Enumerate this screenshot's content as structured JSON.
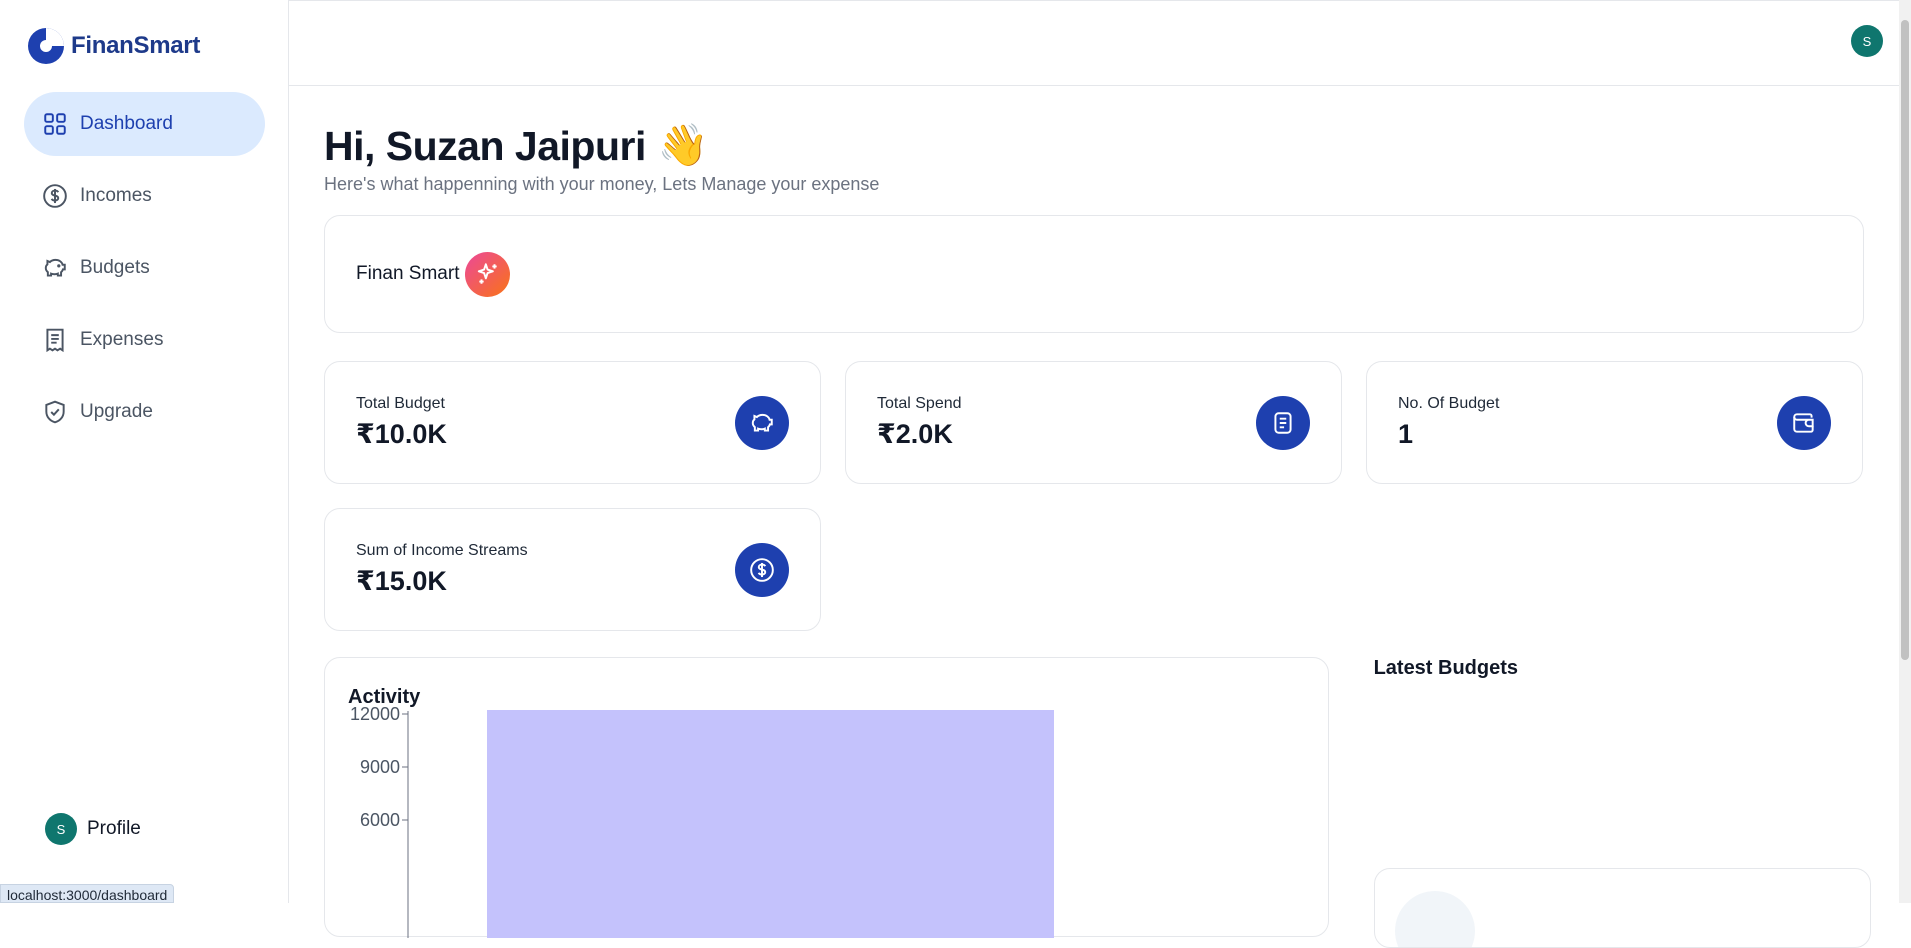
{
  "brand": {
    "name": "FinanSmart"
  },
  "sidebar": {
    "items": [
      {
        "label": "Dashboard",
        "icon": "dashboard-grid-icon",
        "active": true
      },
      {
        "label": "Incomes",
        "icon": "dollar-circle-icon",
        "active": false
      },
      {
        "label": "Budgets",
        "icon": "piggy-bank-icon",
        "active": false
      },
      {
        "label": "Expenses",
        "icon": "receipt-icon",
        "active": false
      },
      {
        "label": "Upgrade",
        "icon": "shield-check-icon",
        "active": false
      }
    ],
    "profile": {
      "label": "Profile",
      "avatar_initial": "S"
    }
  },
  "topbar": {
    "avatar_initial": "S"
  },
  "status_bar": {
    "url": "localhost:3000/dashboard"
  },
  "greeting": {
    "title": "Hi, Suzan Jaipuri",
    "emoji": "👋",
    "subtitle": "Here's what happenning with your money, Lets Manage your expense"
  },
  "ai_card": {
    "label": "Finan Smart",
    "icon": "sparkles-icon"
  },
  "stats": [
    {
      "label": "Total Budget",
      "value": "₹10.0K",
      "icon": "piggy-bank-icon"
    },
    {
      "label": "Total Spend",
      "value": "₹2.0K",
      "icon": "receipt-icon"
    },
    {
      "label": "No. Of Budget",
      "value": "1",
      "icon": "wallet-icon"
    },
    {
      "label": "Sum of Income Streams",
      "value": "₹15.0K",
      "icon": "dollar-circle-icon"
    }
  ],
  "activity": {
    "title": "Activity"
  },
  "latest_budgets": {
    "title": "Latest Budgets"
  },
  "colors": {
    "accent": "#1e40af",
    "active_nav_bg": "#dbeafe",
    "bar": "#c4c2fc",
    "avatar": "#0f766e"
  },
  "chart_data": {
    "type": "bar",
    "title": "Activity",
    "yticks": [
      12000,
      9000,
      6000
    ],
    "ylim": [
      0,
      12000
    ],
    "values": [
      12000
    ]
  }
}
